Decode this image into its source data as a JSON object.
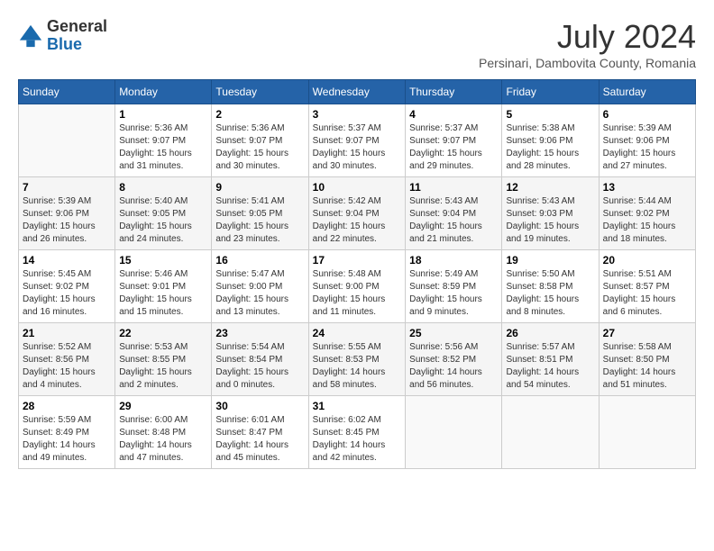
{
  "header": {
    "logo_general": "General",
    "logo_blue": "Blue",
    "month_year": "July 2024",
    "location": "Persinari, Dambovita County, Romania"
  },
  "days_of_week": [
    "Sunday",
    "Monday",
    "Tuesday",
    "Wednesday",
    "Thursday",
    "Friday",
    "Saturday"
  ],
  "weeks": [
    [
      {
        "day": "",
        "info": ""
      },
      {
        "day": "1",
        "info": "Sunrise: 5:36 AM\nSunset: 9:07 PM\nDaylight: 15 hours\nand 31 minutes."
      },
      {
        "day": "2",
        "info": "Sunrise: 5:36 AM\nSunset: 9:07 PM\nDaylight: 15 hours\nand 30 minutes."
      },
      {
        "day": "3",
        "info": "Sunrise: 5:37 AM\nSunset: 9:07 PM\nDaylight: 15 hours\nand 30 minutes."
      },
      {
        "day": "4",
        "info": "Sunrise: 5:37 AM\nSunset: 9:07 PM\nDaylight: 15 hours\nand 29 minutes."
      },
      {
        "day": "5",
        "info": "Sunrise: 5:38 AM\nSunset: 9:06 PM\nDaylight: 15 hours\nand 28 minutes."
      },
      {
        "day": "6",
        "info": "Sunrise: 5:39 AM\nSunset: 9:06 PM\nDaylight: 15 hours\nand 27 minutes."
      }
    ],
    [
      {
        "day": "7",
        "info": "Sunrise: 5:39 AM\nSunset: 9:06 PM\nDaylight: 15 hours\nand 26 minutes."
      },
      {
        "day": "8",
        "info": "Sunrise: 5:40 AM\nSunset: 9:05 PM\nDaylight: 15 hours\nand 24 minutes."
      },
      {
        "day": "9",
        "info": "Sunrise: 5:41 AM\nSunset: 9:05 PM\nDaylight: 15 hours\nand 23 minutes."
      },
      {
        "day": "10",
        "info": "Sunrise: 5:42 AM\nSunset: 9:04 PM\nDaylight: 15 hours\nand 22 minutes."
      },
      {
        "day": "11",
        "info": "Sunrise: 5:43 AM\nSunset: 9:04 PM\nDaylight: 15 hours\nand 21 minutes."
      },
      {
        "day": "12",
        "info": "Sunrise: 5:43 AM\nSunset: 9:03 PM\nDaylight: 15 hours\nand 19 minutes."
      },
      {
        "day": "13",
        "info": "Sunrise: 5:44 AM\nSunset: 9:02 PM\nDaylight: 15 hours\nand 18 minutes."
      }
    ],
    [
      {
        "day": "14",
        "info": "Sunrise: 5:45 AM\nSunset: 9:02 PM\nDaylight: 15 hours\nand 16 minutes."
      },
      {
        "day": "15",
        "info": "Sunrise: 5:46 AM\nSunset: 9:01 PM\nDaylight: 15 hours\nand 15 minutes."
      },
      {
        "day": "16",
        "info": "Sunrise: 5:47 AM\nSunset: 9:00 PM\nDaylight: 15 hours\nand 13 minutes."
      },
      {
        "day": "17",
        "info": "Sunrise: 5:48 AM\nSunset: 9:00 PM\nDaylight: 15 hours\nand 11 minutes."
      },
      {
        "day": "18",
        "info": "Sunrise: 5:49 AM\nSunset: 8:59 PM\nDaylight: 15 hours\nand 9 minutes."
      },
      {
        "day": "19",
        "info": "Sunrise: 5:50 AM\nSunset: 8:58 PM\nDaylight: 15 hours\nand 8 minutes."
      },
      {
        "day": "20",
        "info": "Sunrise: 5:51 AM\nSunset: 8:57 PM\nDaylight: 15 hours\nand 6 minutes."
      }
    ],
    [
      {
        "day": "21",
        "info": "Sunrise: 5:52 AM\nSunset: 8:56 PM\nDaylight: 15 hours\nand 4 minutes."
      },
      {
        "day": "22",
        "info": "Sunrise: 5:53 AM\nSunset: 8:55 PM\nDaylight: 15 hours\nand 2 minutes."
      },
      {
        "day": "23",
        "info": "Sunrise: 5:54 AM\nSunset: 8:54 PM\nDaylight: 15 hours\nand 0 minutes."
      },
      {
        "day": "24",
        "info": "Sunrise: 5:55 AM\nSunset: 8:53 PM\nDaylight: 14 hours\nand 58 minutes."
      },
      {
        "day": "25",
        "info": "Sunrise: 5:56 AM\nSunset: 8:52 PM\nDaylight: 14 hours\nand 56 minutes."
      },
      {
        "day": "26",
        "info": "Sunrise: 5:57 AM\nSunset: 8:51 PM\nDaylight: 14 hours\nand 54 minutes."
      },
      {
        "day": "27",
        "info": "Sunrise: 5:58 AM\nSunset: 8:50 PM\nDaylight: 14 hours\nand 51 minutes."
      }
    ],
    [
      {
        "day": "28",
        "info": "Sunrise: 5:59 AM\nSunset: 8:49 PM\nDaylight: 14 hours\nand 49 minutes."
      },
      {
        "day": "29",
        "info": "Sunrise: 6:00 AM\nSunset: 8:48 PM\nDaylight: 14 hours\nand 47 minutes."
      },
      {
        "day": "30",
        "info": "Sunrise: 6:01 AM\nSunset: 8:47 PM\nDaylight: 14 hours\nand 45 minutes."
      },
      {
        "day": "31",
        "info": "Sunrise: 6:02 AM\nSunset: 8:45 PM\nDaylight: 14 hours\nand 42 minutes."
      },
      {
        "day": "",
        "info": ""
      },
      {
        "day": "",
        "info": ""
      },
      {
        "day": "",
        "info": ""
      }
    ]
  ]
}
